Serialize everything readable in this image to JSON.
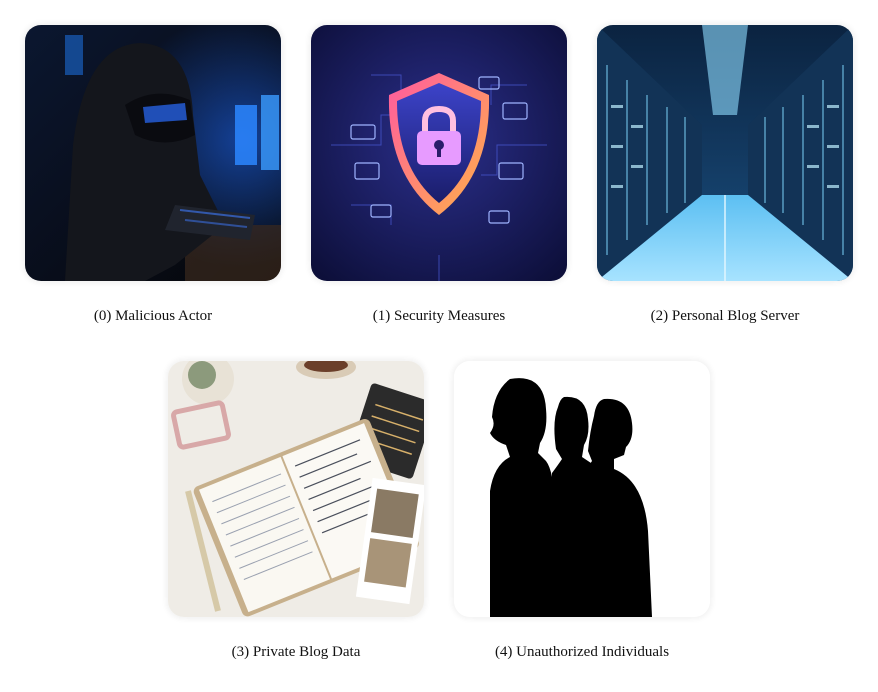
{
  "items": [
    {
      "caption": "(0) Malicious Actor",
      "icon": "hacker-illustration"
    },
    {
      "caption": "(1) Security Measures",
      "icon": "shield-lock-icon"
    },
    {
      "caption": "(2) Personal Blog Server",
      "icon": "server-room-illustration"
    },
    {
      "caption": "(3) Private Blog Data",
      "icon": "journal-notebook-illustration"
    },
    {
      "caption": "(4) Unauthorized Individuals",
      "icon": "silhouette-people-illustration"
    }
  ],
  "colors": {
    "hacker_glow": "#1e6cff",
    "shield_gradient_start": "#ff5aa0",
    "shield_gradient_end": "#ffb347",
    "server_light": "#7fd8ff",
    "silhouette": "#000000"
  }
}
